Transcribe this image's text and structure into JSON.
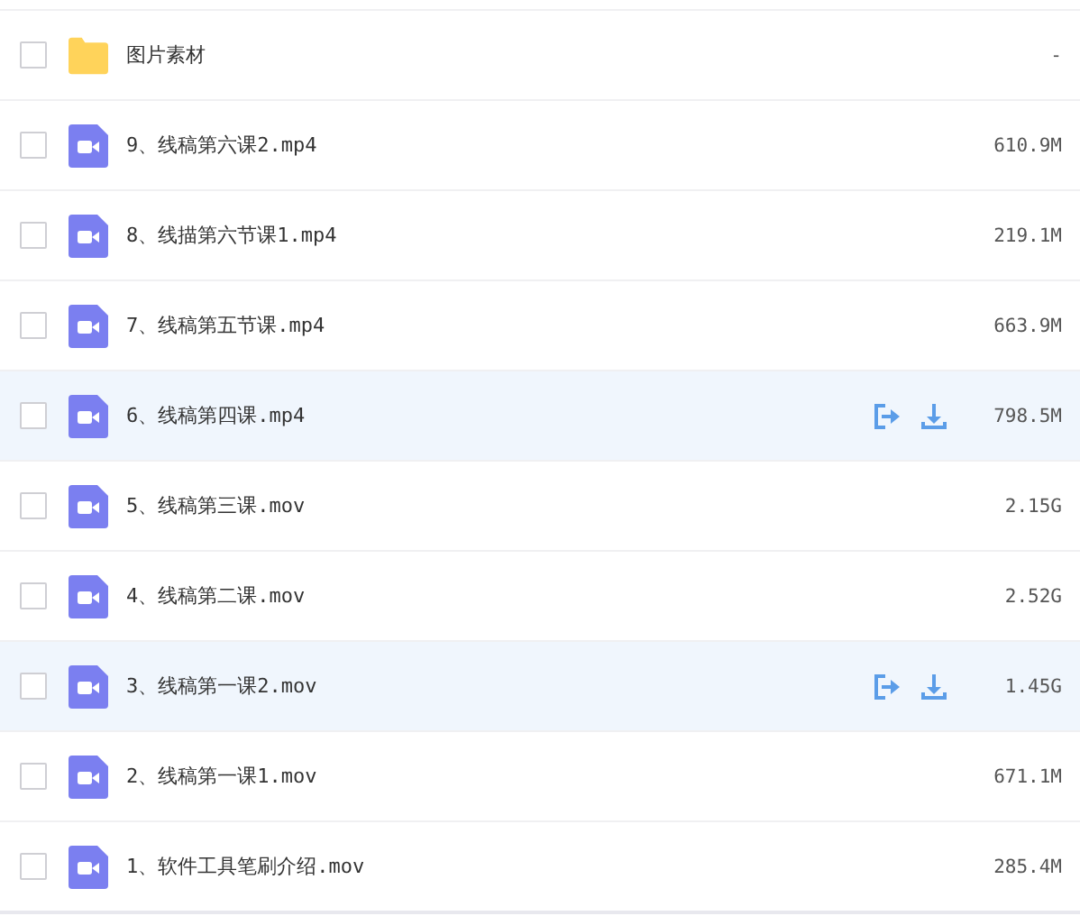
{
  "files": [
    {
      "kind": "folder",
      "name": "图片素材",
      "size": "-",
      "checked": false,
      "highlighted": false
    },
    {
      "kind": "video",
      "name": "9、线稿第六课2.mp4",
      "size": "610.9M",
      "checked": false,
      "highlighted": false
    },
    {
      "kind": "video",
      "name": "8、线描第六节课1.mp4",
      "size": "219.1M",
      "checked": false,
      "highlighted": false
    },
    {
      "kind": "video",
      "name": "7、线稿第五节课.mp4",
      "size": "663.9M",
      "checked": false,
      "highlighted": false
    },
    {
      "kind": "video",
      "name": "6、线稿第四课.mp4",
      "size": "798.5M",
      "checked": false,
      "highlighted": true
    },
    {
      "kind": "video",
      "name": "5、线稿第三课.mov",
      "size": "2.15G",
      "checked": false,
      "highlighted": false
    },
    {
      "kind": "video",
      "name": "4、线稿第二课.mov",
      "size": "2.52G",
      "checked": false,
      "highlighted": false
    },
    {
      "kind": "video",
      "name": "3、线稿第一课2.mov",
      "size": "1.45G",
      "checked": false,
      "highlighted": true
    },
    {
      "kind": "video",
      "name": "2、线稿第一课1.mov",
      "size": "671.1M",
      "checked": false,
      "highlighted": false
    },
    {
      "kind": "video",
      "name": "1、软件工具笔刷介绍.mov",
      "size": "285.4M",
      "checked": false,
      "highlighted": false
    }
  ]
}
